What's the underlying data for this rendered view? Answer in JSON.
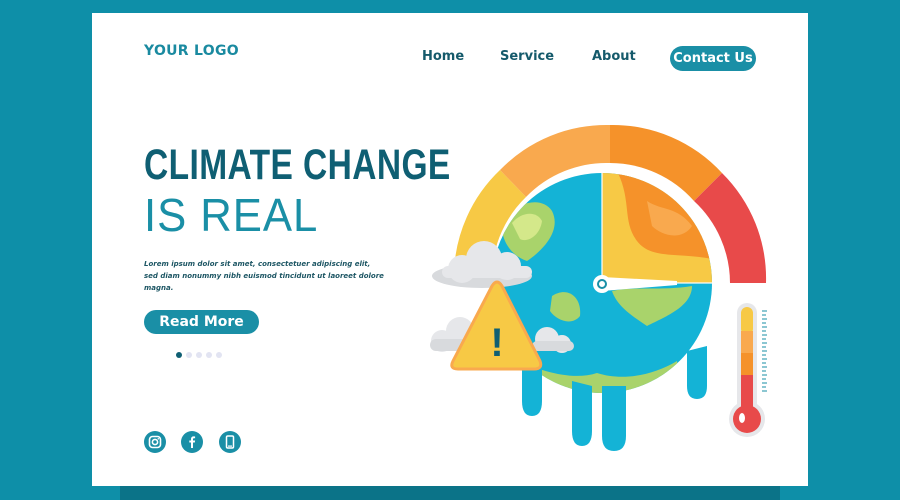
{
  "header": {
    "logo": "YOUR LOGO",
    "nav": [
      {
        "label": "Home"
      },
      {
        "label": "Service"
      },
      {
        "label": "About"
      }
    ],
    "cta": "Contact Us"
  },
  "hero": {
    "title_line1": "CLIMATE CHANGE",
    "title_line2": "IS REAL",
    "body": "Lorem ipsum dolor sit amet, consectetuer adipiscing elit, sed diam nonummy nibh euismod tincidunt ut laoreet dolore magna.",
    "button": "Read More",
    "carousel": {
      "total": 5,
      "active": 1
    }
  },
  "social": [
    {
      "icon": "instagram-icon"
    },
    {
      "icon": "facebook-icon"
    },
    {
      "icon": "phone-icon"
    }
  ],
  "illustration": {
    "alert_symbol": "!",
    "gauge_colors": [
      "#f7c945",
      "#f9a94e",
      "#f5922a",
      "#e84a4a"
    ],
    "colors": {
      "ocean": "#14b3d6",
      "land": "#a9d36b",
      "accent": "#1a8fa6",
      "dark": "#0f5f73",
      "background": "#0e8fa8"
    }
  }
}
